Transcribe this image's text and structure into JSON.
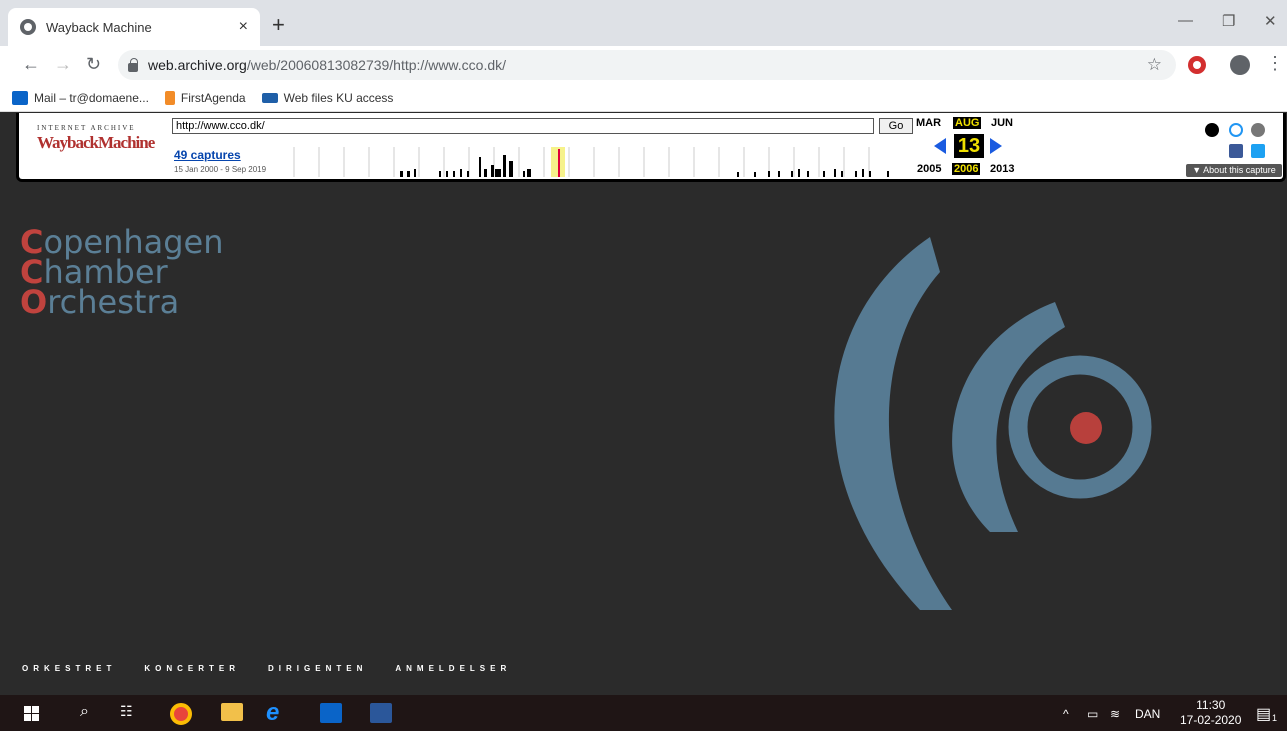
{
  "browser": {
    "tab_title": "Wayback Machine",
    "tab_close": "×",
    "new_tab": "+",
    "url_host": "web.archive.org",
    "url_path": "/web/20060813082739/http://www.cco.dk/"
  },
  "bookmarks": [
    {
      "label": "Mail – tr@domaene...",
      "color": "#0a64c8"
    },
    {
      "label": "FirstAgenda",
      "color": "#f28c28"
    },
    {
      "label": "Web files KU access",
      "color": "#1f5fa8"
    }
  ],
  "wayback": {
    "ia_text": "INTERNET ARCHIVE",
    "logo": "WaybackMachine",
    "url_value": "http://www.cco.dk/",
    "go_label": "Go",
    "captures_label": "49 captures",
    "capture_range": "15 Jan 2000 - 9 Sep 2019",
    "prev_month": "MAR",
    "cur_month": "AUG",
    "next_month": "JUN",
    "day": "13",
    "prev_year": "2005",
    "cur_year": "2006",
    "next_year": "2013",
    "about_label": "▼ About this capture"
  },
  "site": {
    "logo_lines": [
      {
        "cap": "C",
        "rest": "openhagen"
      },
      {
        "cap": "C",
        "rest": "hamber"
      },
      {
        "cap": "O",
        "rest": "rchestra"
      }
    ],
    "nav": [
      "ORKESTRET",
      "KONCERTER",
      "DIRIGENTEN",
      "ANMELDELSER"
    ],
    "colors": {
      "brand_blue": "#567a92",
      "brand_red": "#b8403c",
      "bg": "#2b2b2b"
    }
  },
  "taskbar": {
    "lang": "DAN",
    "time": "11:30",
    "date": "17-02-2020",
    "notif_count": "1"
  }
}
